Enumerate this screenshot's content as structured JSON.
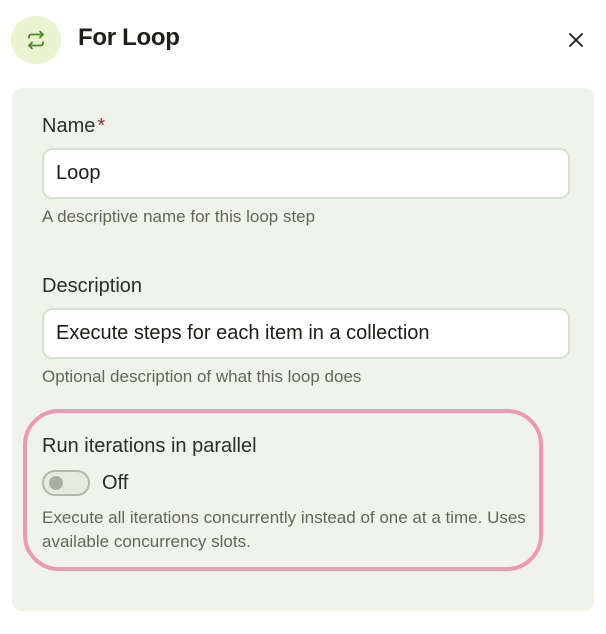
{
  "header": {
    "icon": "loop-arrows-icon",
    "title": "For Loop",
    "close_icon": "close-icon"
  },
  "form": {
    "name": {
      "label": "Name",
      "required_marker": "*",
      "value": "Loop",
      "help": "A descriptive name for this loop step"
    },
    "description": {
      "label": "Description",
      "value": "Execute steps for each item in a collection",
      "help": "Optional description of what this loop does"
    },
    "parallel": {
      "label": "Run iterations in parallel",
      "state": "Off",
      "enabled": false,
      "help": "Execute all iterations concurrently instead of one at a time. Uses available concurrency slots."
    }
  },
  "colors": {
    "panel_bg": "#eff3ea",
    "badge_bg": "#e9f3cf",
    "icon_green": "#4a8a2e",
    "highlight": "#ec9ab3",
    "required": "#8c2f2a"
  }
}
